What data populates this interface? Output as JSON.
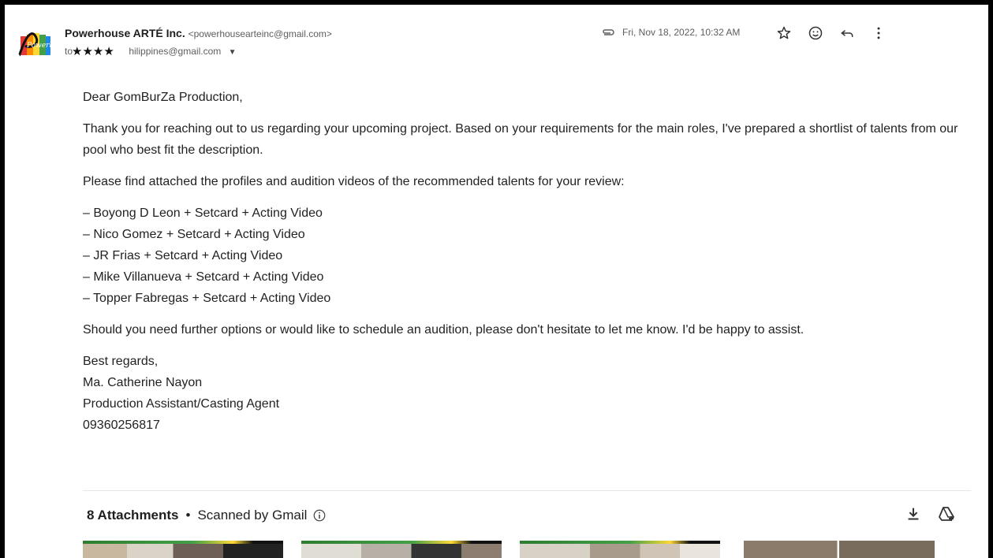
{
  "email": {
    "sender_name": "Powerhouse ARTÉ Inc.",
    "sender_email": "<powerhousearteinc@gmail.com>",
    "to_prefix": "to ",
    "to_suffix": "hilippines@gmail.com",
    "date": "Fri, Nov 18, 2022, 10:32 AM",
    "avatar_text": "Powerhouse",
    "greeting": "Dear GomBurZa Production,",
    "para1": "Thank you for reaching out to us regarding your upcoming project. Based on your requirements for the main roles, I've prepared a shortlist of talents from our pool who best fit the description.",
    "para2": "Please find attached the profiles and audition videos of the recommended talents for your review:",
    "list": [
      "– Boyong D Leon + Setcard + Acting Video",
      "– Nico Gomez  + Setcard + Acting Video",
      "– JR Frias + Setcard + Acting Video",
      "– Mike Villanueva + Setcard + Acting Video",
      "– Topper Fabregas  + Setcard + Acting Video"
    ],
    "para3": "Should you need further options or would like to schedule an audition, please don't hesitate to let me know. I'd be happy to assist.",
    "signoff": "Best regards,",
    "sig_name": "Ma. Catherine Nayon",
    "sig_title": "Production Assistant/Casting Agent",
    "sig_phone": "09360256817"
  },
  "attachments": {
    "count_label": "8 Attachments",
    "separator": "•",
    "scanned_label": "Scanned by Gmail"
  },
  "icons": [
    "paperclip-icon",
    "star-icon",
    "emoji-icon",
    "reply-icon",
    "more-vert-icon",
    "info-icon",
    "download-icon",
    "add-to-drive-icon",
    "dropdown-caret-icon"
  ],
  "colors": {
    "text": "#222222",
    "muted": "#5e5e5e",
    "frame": "#000000"
  }
}
